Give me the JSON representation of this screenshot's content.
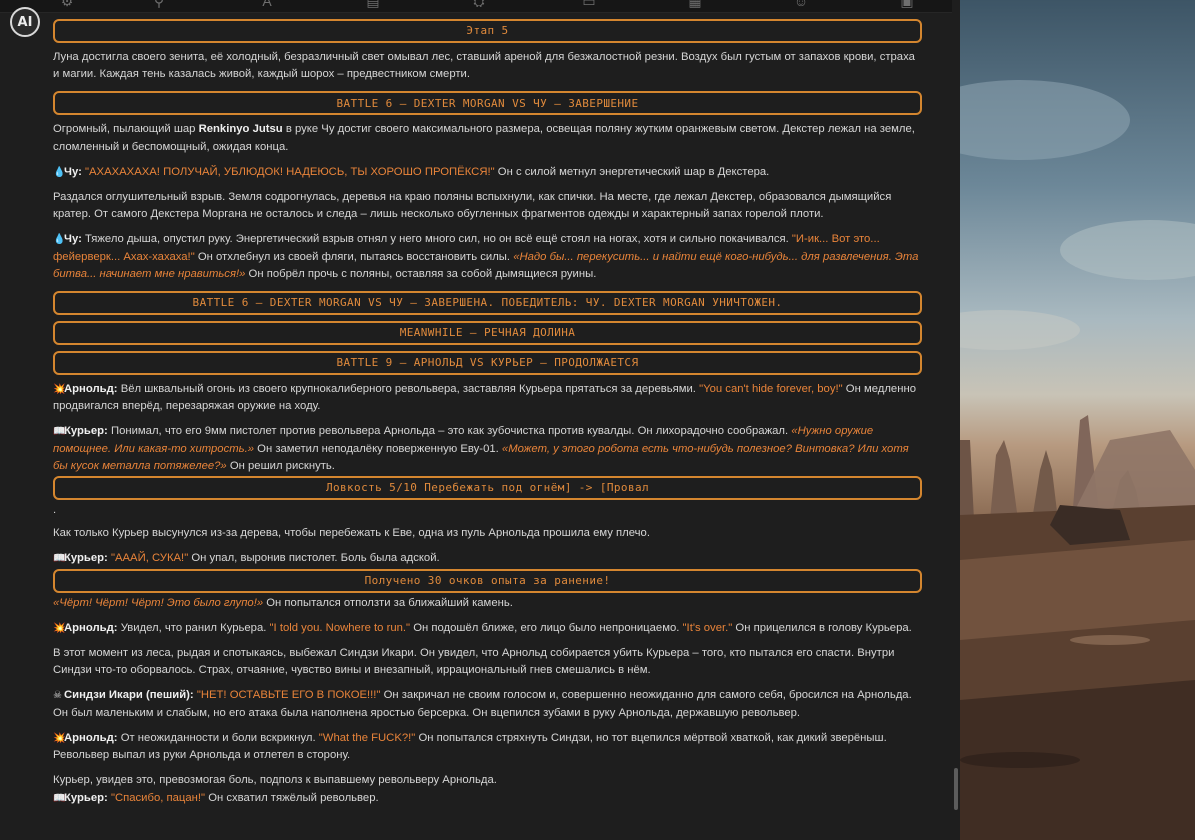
{
  "app": {
    "logo_text": "AI"
  },
  "toolbar": {
    "icons": [
      "sliders-icon",
      "pin-icon",
      "font-icon",
      "document-icon",
      "settings-icon",
      "chat-icon",
      "map-icon",
      "smiley-icon",
      "id-card-icon"
    ]
  },
  "messages": {
    "stage_header": "Этап 5",
    "p1": "Луна достигла своего зенита, её холодный, безразличный свет омывал лес, ставший ареной для безжалостной резни. Воздух был густым от запахов крови, страха и магии. Каждая тень казалась живой, каждый шорох – предвестником смерти.",
    "battle6_final_header": "BATTLE 6 – DEXTER MORGAN VS ЧУ – ЗАВЕРШЕНИЕ",
    "p2a": "Огромный, пылающий шар ",
    "p2b": "Renkinyo Jutsu",
    "p2c": " в руке Чу достиг своего максимального размера, освещая поляну жутким оранжевым светом. Декстер лежал на земле, сломленный и беспомощный, ожидая конца.",
    "chu_name1": "Чу:",
    "chu_quote1": "\"АХАХАХАХА! ПОЛУЧАЙ, УБЛЮДОК! НАДЕЮСЬ, ТЫ ХОРОШО ПРОПЁКСЯ!\"",
    "chu_after1": " Он с силой метнул энергетический шар в Декстера.",
    "p3": "Раздался оглушительный взрыв. Земля содрогнулась, деревья на краю поляны вспыхнули, как спички. На месте, где лежал Декстер, образовался дымящийся кратер. От самого Декстера Моргана не осталось и следа – лишь несколько обугленных фрагментов одежды и характерный запах горелой плоти.",
    "chu_name2": "Чу:",
    "chu_text2": " Тяжело дыша, опустил руку. Энергетический взрыв отнял у него много сил, но он всё ещё стоял на ногах, хотя и сильно покачивался. ",
    "chu_quote2": "\"И-ик... Вот это... фейерверк... Ахах-хахаха!\"",
    "chu_text2b": " Он отхлебнул из своей фляги, пытаясь восстановить силы. ",
    "chu_thought2": "«Надо бы... перекусить... и найти ещё кого-нибудь... для развлечения. Эта битва... начинает мне нравиться!»",
    "chu_text2c": " Он побрёл прочь с поляны, оставляя за собой дымящиеся руины.",
    "battle6_done_header": "BATTLE 6 – DEXTER MORGAN VS ЧУ – ЗАВЕРШЕНА. ПОБЕДИТЕЛЬ: ЧУ. DEXTER MORGAN УНИЧТОЖЕН.",
    "meanwhile_header": "MEANWHILE – РЕЧНАЯ ДОЛИНА",
    "battle9_header": "BATTLE 9 – АРНОЛЬД VS КУРЬЕР – ПРОДОЛЖАЕТСЯ",
    "arnold_name1": "Арнольд:",
    "arnold_text1": " Вёл шквальный огонь из своего крупнокалиберного револьвера, заставляя Курьера прятаться за деревьями. ",
    "arnold_quote1": "\"You can't hide forever, boy!\"",
    "arnold_text1b": " Он медленно продвигался вперёд, перезаряжая оружие на ходу.",
    "courier_name1": "Курьер:",
    "courier_text1": " Понимал, что его 9мм пистолет против револьвера Арнольда – это как зубочистка против кувалды. Он лихорадочно соображал. ",
    "courier_thought1": "«Нужно оружие помощнее. Или какая-то хитрость.»",
    "courier_text1b": " Он заметил неподалёку поверженную Еву-01. ",
    "courier_thought1b": "«Может, у этого робота есть что-нибудь полезное? Винтовка? Или хотя бы кусок металла потяжелее?»",
    "courier_text1c": " Он решил рискнуть.",
    "roll_header": "Ловкость 5/10 Перебежать под огнём] -> [Провал",
    "dot": ".",
    "p4": "Как только Курьер высунулся из-за дерева, чтобы перебежать к Еве, одна из пуль Арнольда прошила ему плечо.",
    "courier_name2": "Курьер:",
    "courier_quote2": "\"АААЙ, СУКА!\"",
    "courier_text2": " Он упал, выронив пистолет. Боль была адской.",
    "xp_header": "Получено 30 очков опыта за ранение!",
    "courier_thought3": "«Чёрт! Чёрт! Чёрт! Это было глупо!»",
    "courier_text3": " Он попытался отползти за ближайший камень.",
    "arnold_name2": "Арнольд:",
    "arnold_text2": " Увидел, что ранил Курьера. ",
    "arnold_quote2": "\"I told you. Nowhere to run.\"",
    "arnold_text2b": " Он подошёл ближе, его лицо было непроницаемо. ",
    "arnold_quote2b": "\"It's over.\"",
    "arnold_text2c": " Он прицелился в голову Курьера.",
    "p5": "В этот момент из леса, рыдая и спотыкаясь, выбежал Синдзи Икари. Он увидел, что Арнольд собирается убить Курьера – того, кто пытался его спасти. Внутри Синдзи что-то оборвалось. Страх, отчаяние, чувство вины и внезапный, иррациональный гнев смешались в нём.",
    "shinji_name": "Синдзи Икари (пеший):",
    "shinji_quote": "\"НЕТ! ОСТАВЬТЕ ЕГО В ПОКОЕ!!!\"",
    "shinji_text": " Он закричал не своим голосом и, совершенно неожиданно для самого себя, бросился на Арнольда. Он был маленьким и слабым, но его атака была наполнена яростью берсерка. Он вцепился зубами в руку Арнольда, державшую револьвер.",
    "arnold_name3": "Арнольд:",
    "arnold_text3": " От неожиданности и боли вскрикнул. ",
    "arnold_quote3": "\"What the FUCK?!\"",
    "arnold_text3b": " Он попытался стряхнуть Синдзи, но тот вцепился мёртвой хваткой, как дикий зверёныш. Револьвер выпал из руки Арнольда и отлетел в сторону.",
    "p6": "Курьер, увидев это, превозмогая боль, подполз к выпавшему револьверу Арнольда.",
    "courier_name4": "Курьер:",
    "courier_quote4": "\"Спасибо, пацан!\"",
    "courier_text4": " Он схватил тяжёлый револьвер."
  }
}
